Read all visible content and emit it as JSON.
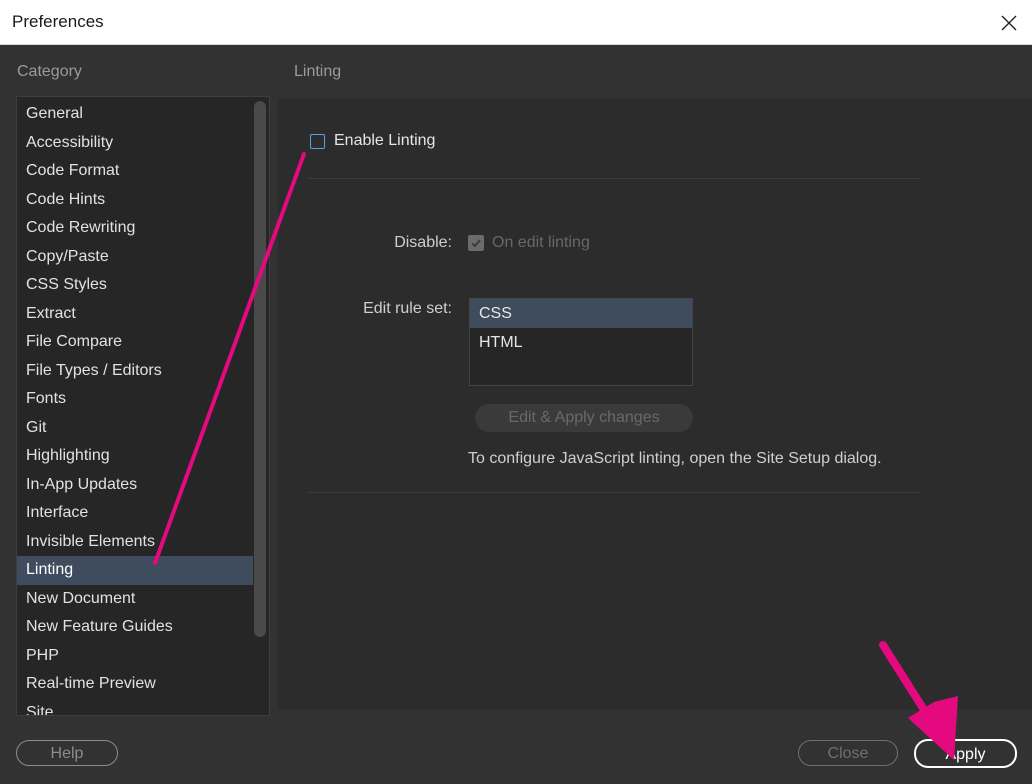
{
  "window": {
    "title": "Preferences"
  },
  "category": {
    "header": "Category",
    "items": [
      "General",
      "Accessibility",
      "Code Format",
      "Code Hints",
      "Code Rewriting",
      "Copy/Paste",
      "CSS Styles",
      "Extract",
      "File Compare",
      "File Types / Editors",
      "Fonts",
      "Git",
      "Highlighting",
      "In-App Updates",
      "Interface",
      "Invisible Elements",
      "Linting",
      "New Document",
      "New Feature Guides",
      "PHP",
      "Real-time Preview",
      "Site"
    ],
    "selected": "Linting"
  },
  "linting": {
    "header": "Linting",
    "enable_label": "Enable Linting",
    "enable_checked": false,
    "disable_label": "Disable:",
    "disable_option_label": "On edit linting",
    "disable_option_checked": true,
    "ruleset_label": "Edit rule set:",
    "rulesets": [
      "CSS",
      "HTML"
    ],
    "ruleset_selected": "CSS",
    "edit_apply_label": "Edit  & Apply changes",
    "js_note": "To configure JavaScript linting, open the Site Setup dialog."
  },
  "footer": {
    "help_label": "Help",
    "close_label": "Close",
    "apply_label": "Apply"
  },
  "colors": {
    "annotation": "#e5097f",
    "selection": "#3e4c5d",
    "checkbox_accent": "#5aa0e6"
  }
}
